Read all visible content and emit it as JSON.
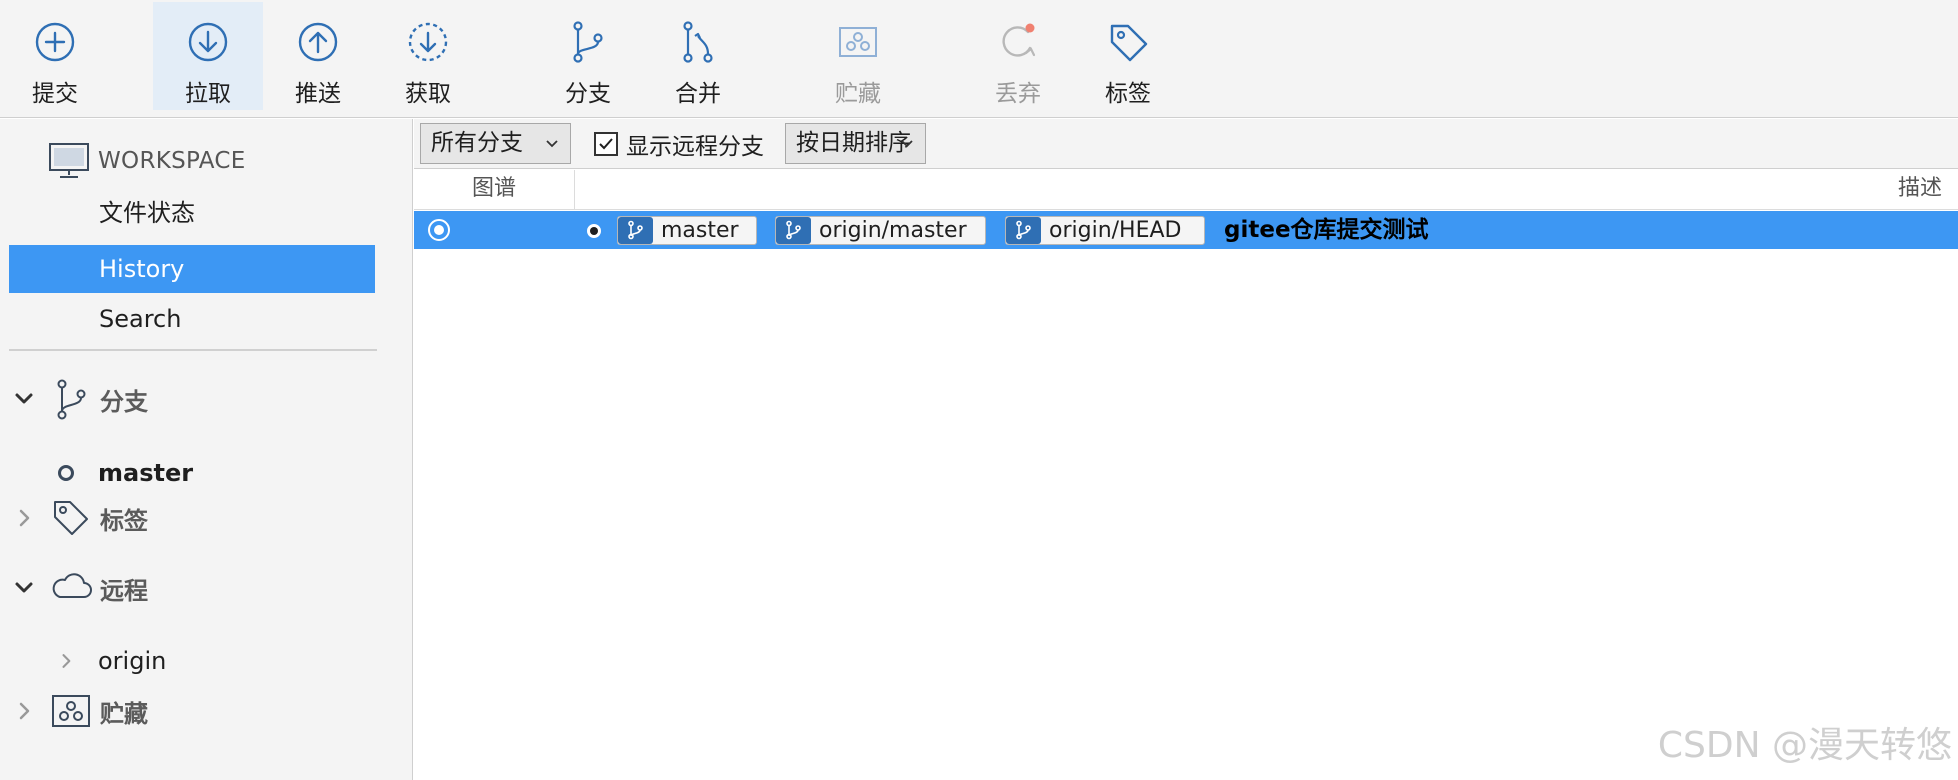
{
  "toolbar": {
    "items": [
      {
        "label": "提交",
        "icon": "commit-icon",
        "state": "normal"
      },
      {
        "label": "拉取",
        "icon": "pull-icon",
        "state": "active"
      },
      {
        "label": "推送",
        "icon": "push-icon",
        "state": "normal"
      },
      {
        "label": "获取",
        "icon": "fetch-icon",
        "state": "normal"
      },
      {
        "label": "分支",
        "icon": "branch-icon",
        "state": "normal"
      },
      {
        "label": "合并",
        "icon": "merge-icon",
        "state": "normal"
      },
      {
        "label": "贮藏",
        "icon": "stash-icon",
        "state": "disabled"
      },
      {
        "label": "丢弃",
        "icon": "discard-icon",
        "state": "disabled"
      },
      {
        "label": "标签",
        "icon": "tag-icon",
        "state": "normal"
      }
    ]
  },
  "sidebar": {
    "workspace": {
      "label": "WORKSPACE",
      "icon": "monitor-icon"
    },
    "nav": [
      {
        "label": "文件状态",
        "selected": false
      },
      {
        "label": "History",
        "selected": true
      },
      {
        "label": "Search",
        "selected": false
      }
    ],
    "sections": {
      "branches": {
        "title": "分支",
        "expanded": true,
        "icon": "branch-icon",
        "items": [
          {
            "label": "master",
            "current": true
          }
        ]
      },
      "tags": {
        "title": "标签",
        "expanded": false,
        "icon": "tag-icon"
      },
      "remotes": {
        "title": "远程",
        "expanded": true,
        "icon": "cloud-icon",
        "items": [
          {
            "label": "origin",
            "expanded": false
          }
        ]
      },
      "stashes": {
        "title": "贮藏",
        "expanded": false,
        "icon": "stash-icon"
      }
    }
  },
  "main": {
    "filter": {
      "branch_select": "所有分支",
      "show_remote_label": "显示远程分支",
      "show_remote_checked": true,
      "sort_select": "按日期排序"
    },
    "columns": {
      "graph": "图谱",
      "description": "描述"
    },
    "commits": [
      {
        "refs": [
          "master",
          "origin/master",
          "origin/HEAD"
        ],
        "message": "gitee仓库提交测试",
        "selected": true
      }
    ]
  },
  "watermark": "CSDN @漫天转悠",
  "colors": {
    "accent": "#3d97f3",
    "icon_blue": "#2f6fb4",
    "toolbar_bg": "#f4f4f4",
    "discard_dot": "#f08070"
  }
}
